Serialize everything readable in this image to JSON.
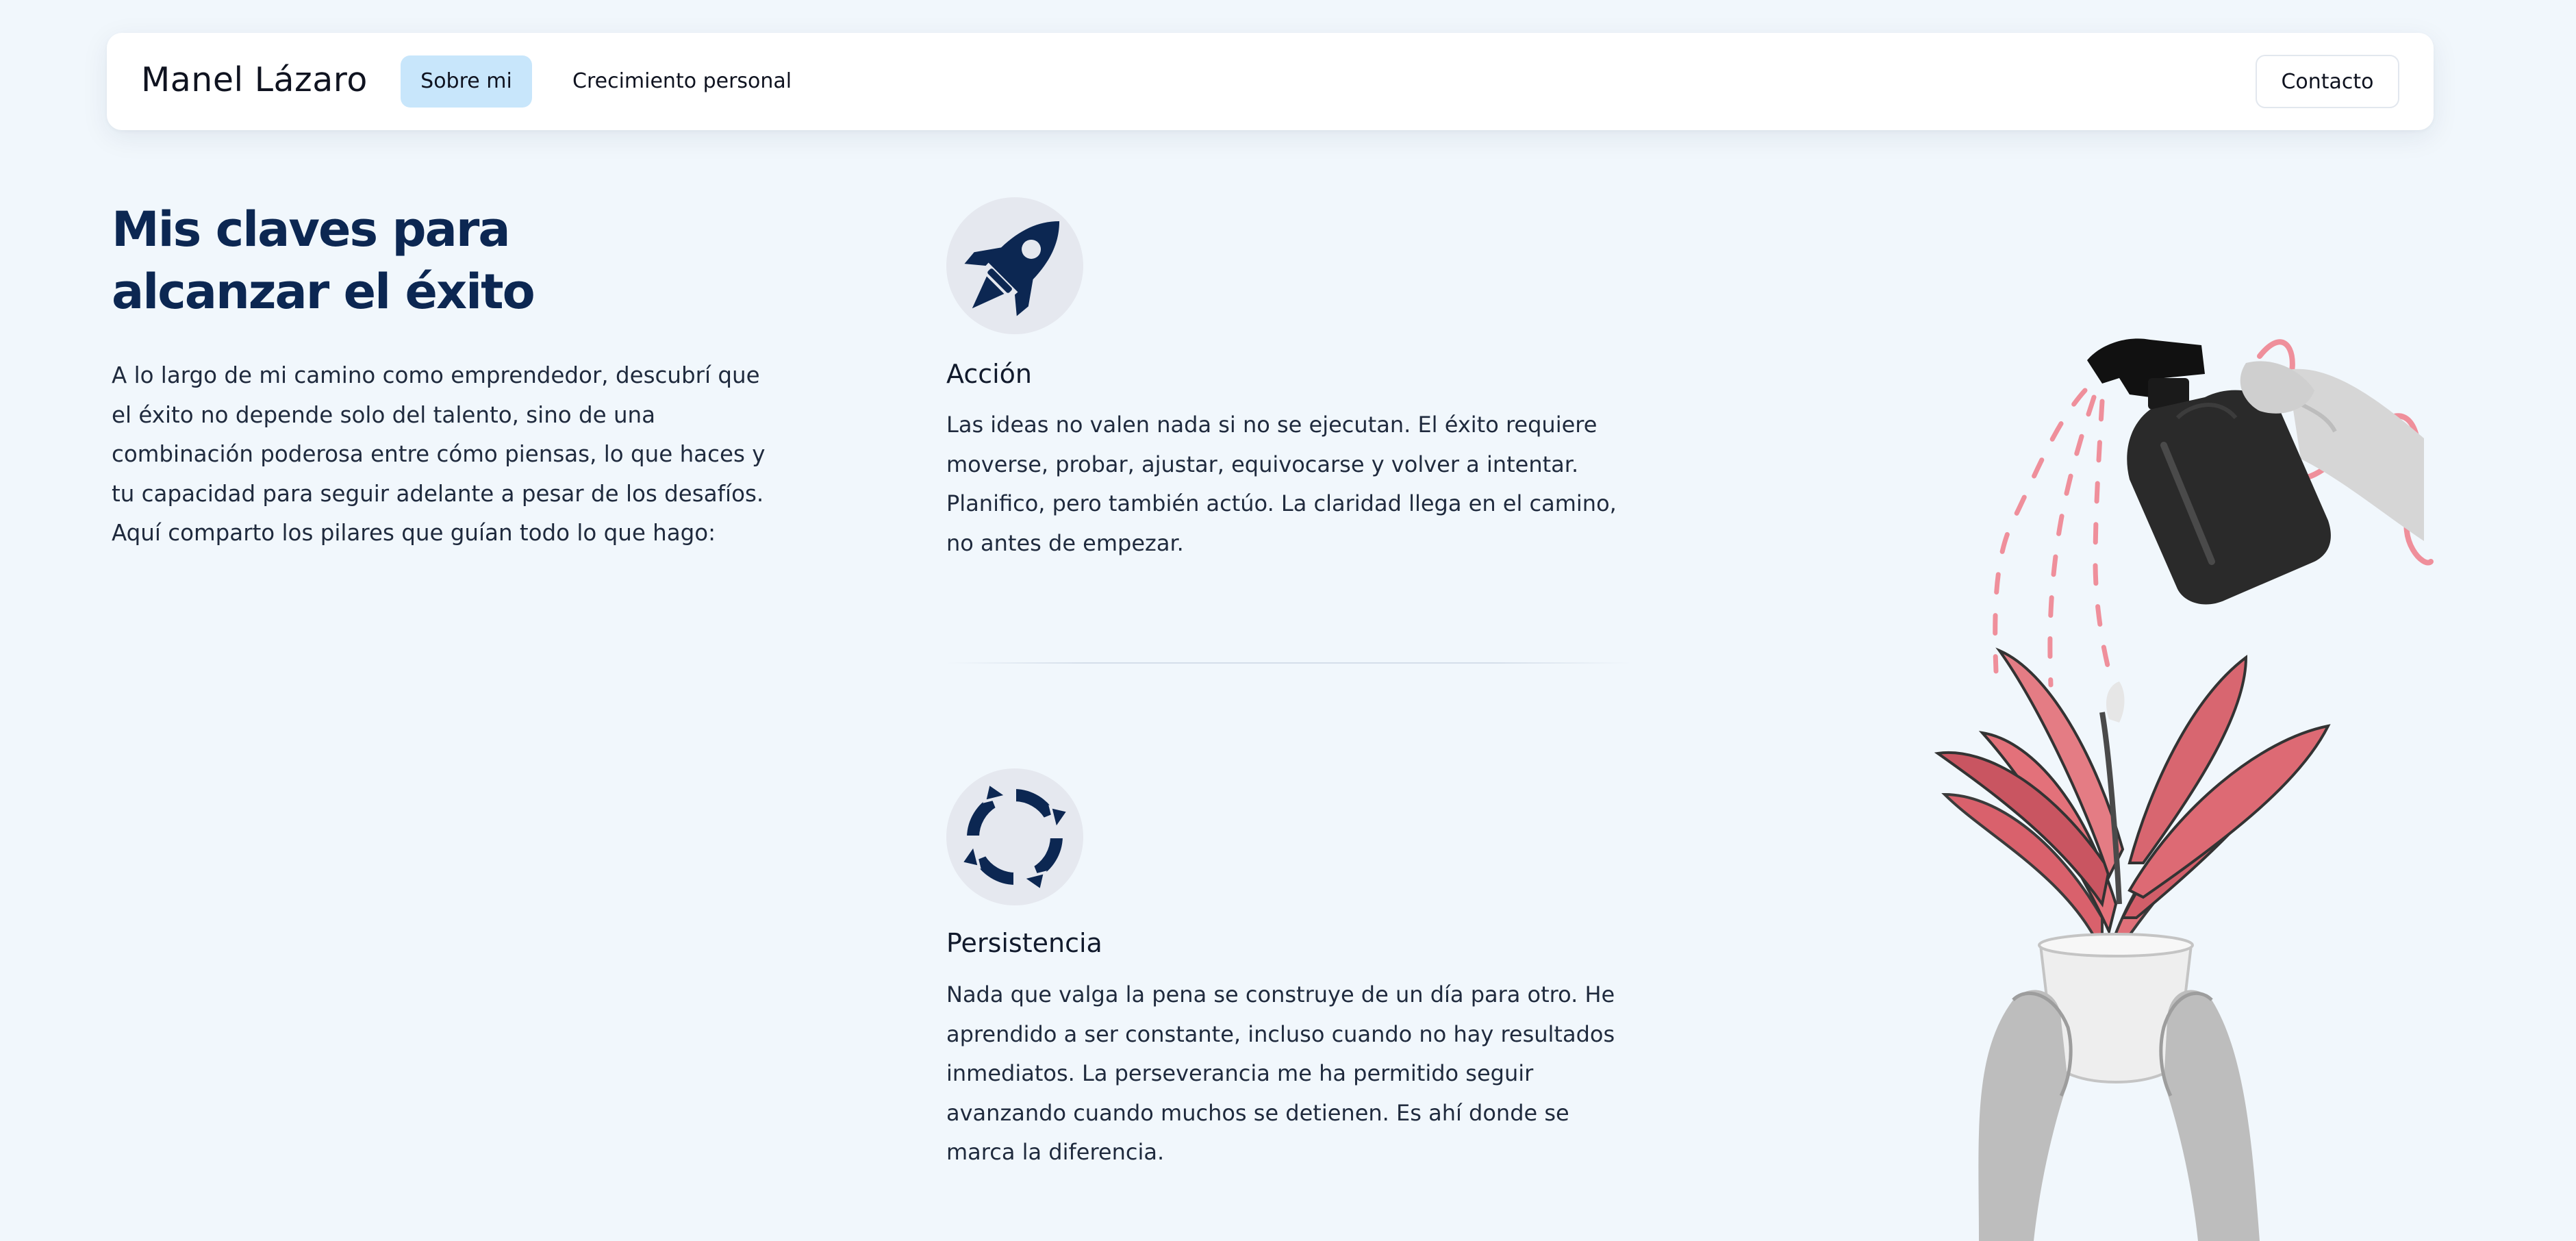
{
  "header": {
    "brand": "Manel Lázaro",
    "nav": [
      {
        "label": "Sobre mi",
        "active": true
      },
      {
        "label": "Crecimiento personal",
        "active": false
      }
    ],
    "contact_label": "Contacto"
  },
  "intro": {
    "title_line1": "Mis claves para",
    "title_line2": "alcanzar el éxito",
    "paragraph": "A lo largo de mi camino como emprendedor, descubrí que el éxito no depende solo del talento, sino de una combinación poderosa entre cómo piensas, lo que haces y tu capacidad para seguir adelante a pesar de los desafíos. Aquí comparto los pilares que guían todo lo que hago:"
  },
  "pillars": [
    {
      "icon": "rocket-icon",
      "title": "Acción",
      "text": "Las ideas no valen nada si no se ejecutan. El éxito requiere moverse, probar, ajustar, equivocarse y volver a intentar. Planifico, pero también actúo. La claridad llega en el camino, no antes de empezar."
    },
    {
      "icon": "cycle-arrows-icon",
      "title": "Persistencia",
      "text": "Nada que valga la pena se construye de un día para otro. He aprendido a ser constante, incluso cuando no hay resultados inmediatos. La perseverancia me ha permitido seguir avanzando cuando muchos se detienen. Es ahí donde se marca la diferencia."
    }
  ],
  "colors": {
    "background": "#f1f7fc",
    "heading": "#0c2752",
    "icon": "#0c2752",
    "active_nav": "#c8e6fb",
    "accent_pink": "#ef8f9b"
  }
}
